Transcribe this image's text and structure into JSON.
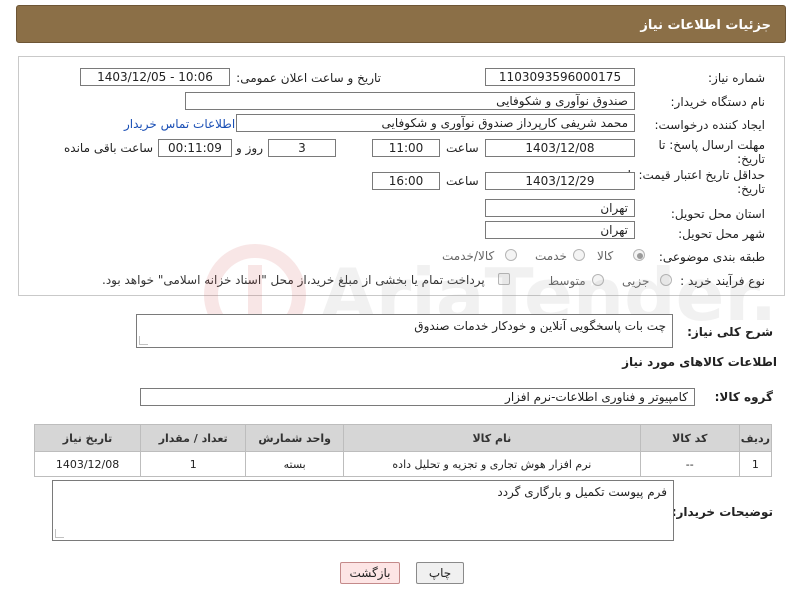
{
  "header": {
    "title": "جزئیات اطلاعات نیاز"
  },
  "form": {
    "need_number_label": "شماره نیاز:",
    "need_number": "1103093596000175",
    "announce_label": "تاریخ و ساعت اعلان عمومی:",
    "announce_value": "1403/12/05 - 10:06",
    "buyer_org_label": "نام دستگاه خریدار:",
    "buyer_org": "صندوق نوآوری و شکوفایی",
    "creator_label": "ایجاد کننده درخواست:",
    "creator": "محمد  شریفی کارپرداز صندوق نوآوری و شکوفایی",
    "contact_link": "اطلاعات تماس خریدار",
    "deadline_label_1": "مهلت ارسال پاسخ: تا",
    "deadline_label_2": "تاریخ:",
    "deadline_date": "1403/12/08",
    "time_label": "ساعت",
    "deadline_time": "11:00",
    "days_value": "3",
    "days_label": "روز و",
    "remaining_value": "00:11:09",
    "remaining_label": "ساعت باقی مانده",
    "validity_label_1": "حداقل تاریخ اعتبار قیمت: تا",
    "validity_label_2": "تاریخ:",
    "validity_date": "1403/12/29",
    "validity_time_label": "ساعت",
    "validity_time": "16:00",
    "province_label": "استان محل تحویل:",
    "province": "تهران",
    "city_label": "شهر محل تحویل:",
    "city": "تهران",
    "category_label": "طبقه بندی موضوعی:",
    "category_options": [
      "کالا",
      "خدمت",
      "کالا/خدمت"
    ],
    "process_label": "نوع فرآیند خرید :",
    "process_options": [
      "جزیی",
      "متوسط"
    ],
    "payment_note": "پرداخت تمام یا بخشی از مبلغ خرید،از محل \"اسناد خزانه اسلامی\" خواهد بود."
  },
  "description": {
    "label": "شرح کلی نیاز:",
    "text": "چت بات پاسخگویی آنلاین و خودکار خدمات صندوق"
  },
  "goods": {
    "section_title": "اطلاعات کالاهای مورد نیاز",
    "group_label": "گروه کالا:",
    "group_value": "کامپیوتر و فناوری اطلاعات-نرم افزار",
    "columns": [
      "ردیف",
      "کد کالا",
      "نام کالا",
      "واحد شمارش",
      "تعداد / مقدار",
      "تاریخ نیاز"
    ],
    "rows": [
      {
        "row": "1",
        "code": "--",
        "name": "نرم افزار هوش تجاری و تجزیه و تحلیل داده",
        "unit": "بسته",
        "qty": "1",
        "date": "1403/12/08"
      }
    ]
  },
  "buyer_notes": {
    "label": "توضیحات خریدار:",
    "text": "فرم پیوست تکمیل و بارگاری گردد"
  },
  "buttons": {
    "print": "چاپ",
    "back": "بازگشت"
  },
  "watermark": {
    "text": "AriaTender.neT"
  },
  "colors": {
    "header_bg": "#8b6f47",
    "link": "#1a4fb5",
    "back_button_bg": "#fde5e5"
  }
}
